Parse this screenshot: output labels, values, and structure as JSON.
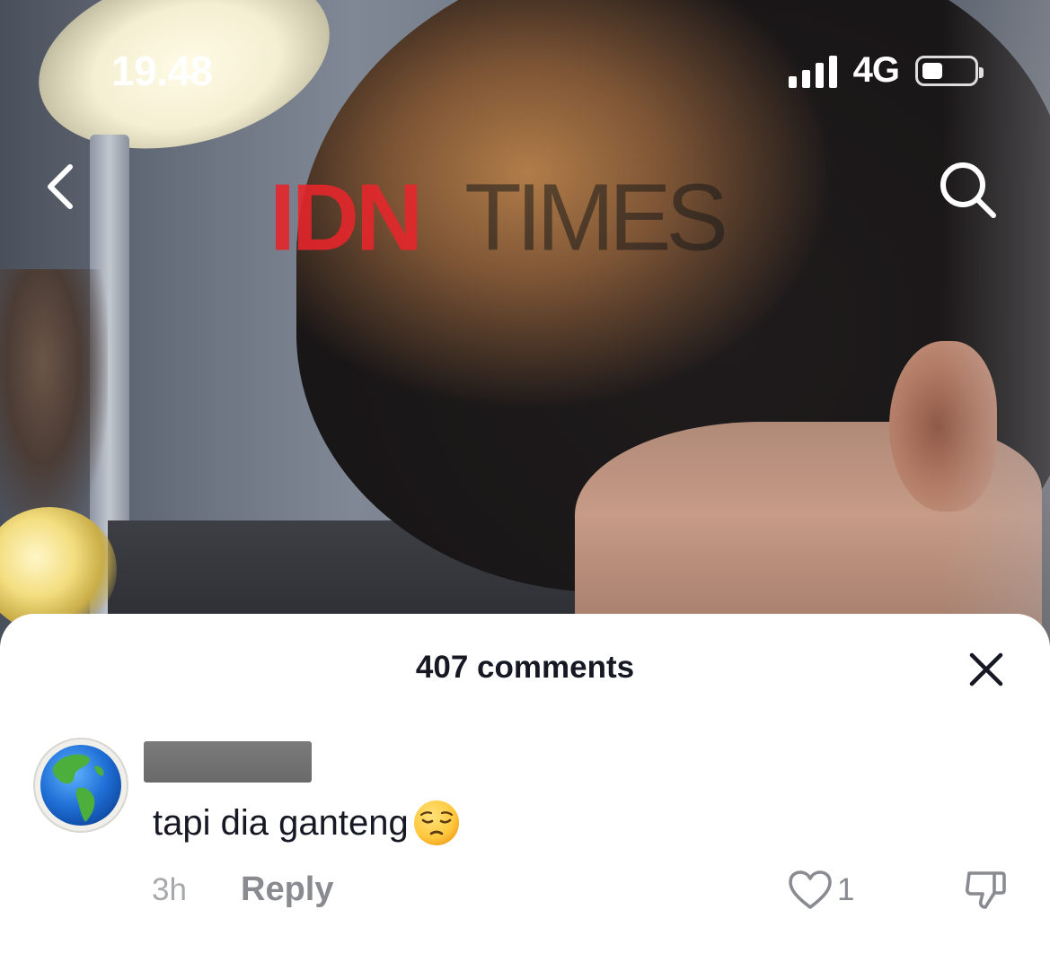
{
  "status_bar": {
    "time": "19.48",
    "network": "4G",
    "signal_bars": 4,
    "battery_level": 0.4
  },
  "video": {
    "watermark_brand": "IDN",
    "watermark_rest": "TIMES"
  },
  "nav": {
    "back_icon": "chevron-left-icon",
    "search_icon": "search-icon"
  },
  "comments_sheet": {
    "title": "407 comments",
    "close_icon": "close-icon",
    "comments": [
      {
        "avatar_icon": "globe-americas-emoji",
        "username_redacted": true,
        "text": "tapi dia ganteng",
        "emoji": "pensive-face-emoji",
        "time": "3h",
        "reply_label": "Reply",
        "like_count": "1",
        "like_icon": "heart-outline-icon",
        "dislike_icon": "thumbs-down-icon"
      }
    ]
  },
  "colors": {
    "accent_red": "#e5262c",
    "text_primary": "#161823",
    "text_secondary": "#8a8b91",
    "text_muted": "#a7a8ab"
  }
}
